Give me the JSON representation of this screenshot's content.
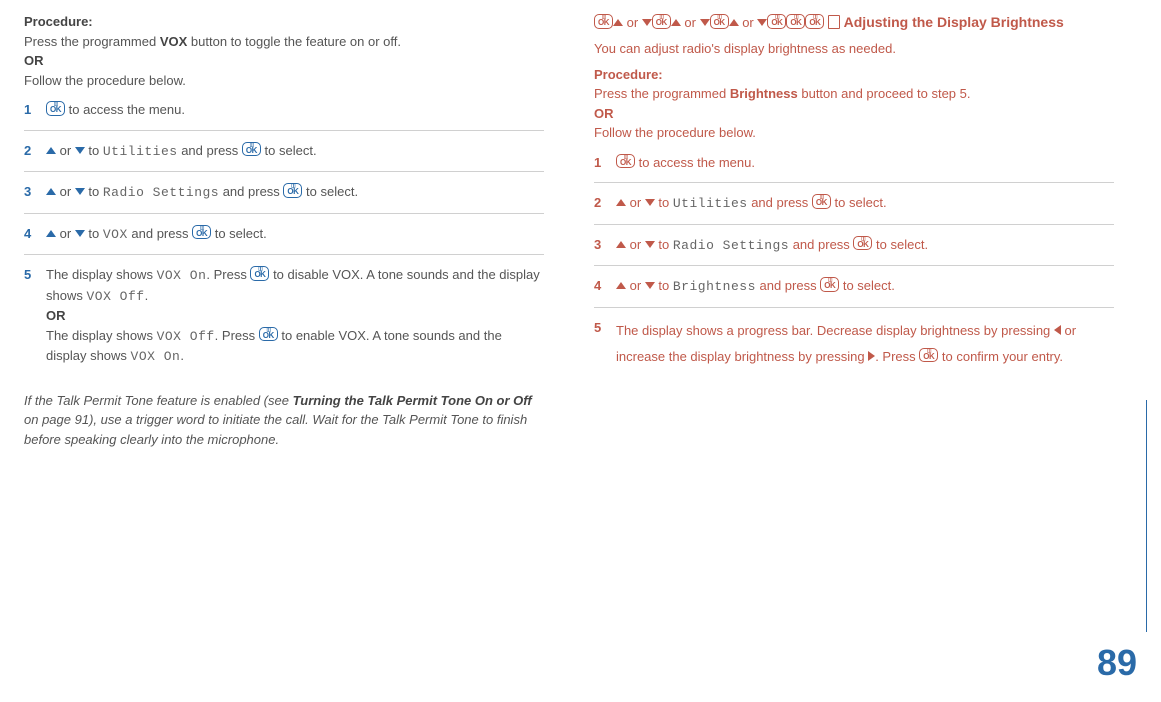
{
  "left": {
    "procLabel": "Procedure:",
    "intro1a": "Press the programmed ",
    "intro1b": "VOX",
    "intro1c": " button to toggle the feature on or off.",
    "or": "OR",
    "intro2": "Follow the procedure below.",
    "steps": {
      "s1": {
        "num": "1",
        "t1": " to access the menu."
      },
      "s2": {
        "num": "2",
        "t1": " or ",
        "t2": " to ",
        "menu": "Utilities",
        "t3": " and press ",
        "t4": " to select."
      },
      "s3": {
        "num": "3",
        "t1": " or ",
        "t2": " to ",
        "menu": "Radio Settings",
        "t3": " and press ",
        "t4": " to select."
      },
      "s4": {
        "num": "4",
        "t1": " or ",
        "t2": " to ",
        "menu": "VOX",
        "t3": " and press ",
        "t4": " to select."
      },
      "s5": {
        "num": "5",
        "la": "The display shows ",
        "lon": " VOX On",
        "lb": ". Press ",
        "lc": " to disable VOX. A tone sounds and the display shows ",
        "loff": "VOX Off",
        "ld": ".",
        "or": "OR",
        "ra": "The display shows ",
        "roff": " VOX Off",
        "rb": ". Press ",
        "rc": " to enable VOX. A tone sounds and the display shows ",
        "ron": "VOX On",
        "rd": "."
      }
    },
    "note1a": "If the Talk Permit Tone feature is enabled (see ",
    "note1b": "Turning the Talk Permit Tone On or Off",
    "note1c": " on page 91), use a trigger word to initiate the call. Wait for the Talk Permit Tone to finish before speaking clearly into the microphone."
  },
  "right": {
    "headOr": " or ",
    "headTitle": " Adjusting the Display Brightness",
    "sub": "You can adjust radio's display brightness as needed.",
    "procLabel": "Procedure:",
    "intro1a": "Press the programmed ",
    "intro1b": "Brightness",
    "intro1c": " button and proceed to step 5.",
    "or": "OR",
    "intro2": "Follow the procedure below.",
    "steps": {
      "s1": {
        "num": "1",
        "t1": " to access the menu."
      },
      "s2": {
        "num": "2",
        "t1": " or ",
        "t2": " to ",
        "menu": "Utilities",
        "t3": " and press ",
        "t4": " to select."
      },
      "s3": {
        "num": "3",
        "t1": " or ",
        "t2": " to ",
        "menu": "Radio Settings",
        "t3": " and press ",
        "t4": " to select."
      },
      "s4": {
        "num": "4",
        "t1": " or ",
        "t2": " to ",
        "menu": "Brightness",
        "t3": " and press ",
        "t4": " to select."
      },
      "s5": {
        "num": "5",
        "a": "The display shows a progress bar. Decrease display brightness by pressing ",
        "b": " or increase the display brightness by pressing ",
        "c": ". Press ",
        "d": " to confirm your entry."
      }
    }
  },
  "ok": "OK",
  "pageNumber": "89"
}
